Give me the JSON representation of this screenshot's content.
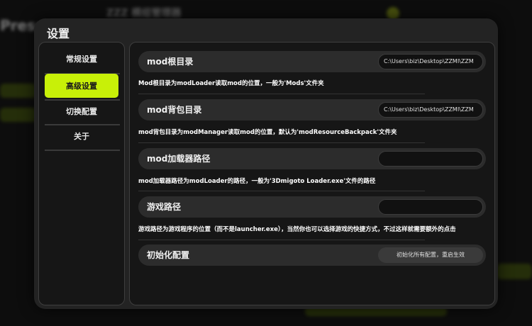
{
  "background": {
    "title": "Prese",
    "brand": "ZZZ 模组管理器"
  },
  "dialog": {
    "title": "设置"
  },
  "sidebar": {
    "items": [
      {
        "label": "常规设置",
        "active": false
      },
      {
        "label": "高级设置",
        "active": true
      },
      {
        "label": "切换配置",
        "active": false
      },
      {
        "label": "关于",
        "active": false
      }
    ]
  },
  "settings": {
    "mod_root": {
      "label": "mod根目录",
      "value": "C:\\Users\\biz\\Desktop\\ZZMI\\ZZM",
      "description": "Mod根目录为modLoader读取mod的位置，一般为'Mods'文件夹"
    },
    "mod_backpack": {
      "label": "mod背包目录",
      "value": "C:\\Users\\biz\\Desktop\\ZZMI\\ZZM",
      "description": "mod背包目录为modManager读取mod的位置，默认为'modResourceBackpack'文件夹"
    },
    "mod_loader": {
      "label": "mod加载器路径",
      "value": "",
      "description": "mod加载器路径为modLoader的路径，一般为'3Dmigoto Loader.exe'文件的路径"
    },
    "game_path": {
      "label": "游戏路径",
      "value": "",
      "description": "游戏路径为游戏程序的位置（而不是launcher.exe），当然你也可以选择游戏的快捷方式，不过这样就需要额外的点击"
    },
    "init_config": {
      "label": "初始化配置",
      "button": "初始化所有配置，重启生效"
    }
  },
  "colors": {
    "accent": "#c8f008",
    "panel": "#161616",
    "dialog": "#232323",
    "row": "#2c2c2c"
  }
}
